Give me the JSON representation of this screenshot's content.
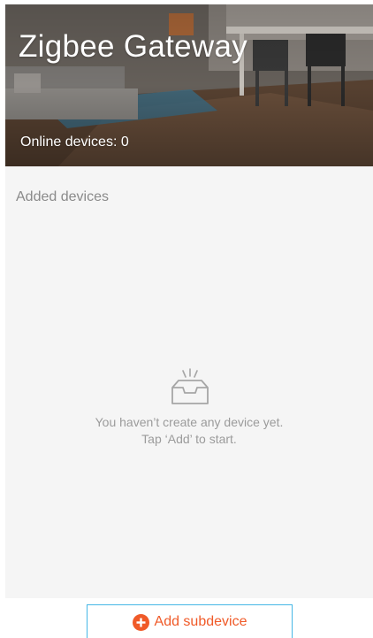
{
  "header": {
    "title": "Zigbee Gateway",
    "online_devices": "Online devices: 0"
  },
  "content": {
    "section_title": "Added devices",
    "empty_state": {
      "icon": "empty-inbox-icon",
      "line1": "You haven’t create any device yet.",
      "line2": "Tap ‘Add’ to start."
    }
  },
  "footer": {
    "add_button_label": "Add subdevice",
    "add_icon": "plus-circle-icon"
  },
  "colors": {
    "accent_orange": "#f05a28",
    "button_border_blue": "#45b7e6",
    "content_background": "#f5f5f5",
    "muted_text": "#8a8a8a"
  }
}
